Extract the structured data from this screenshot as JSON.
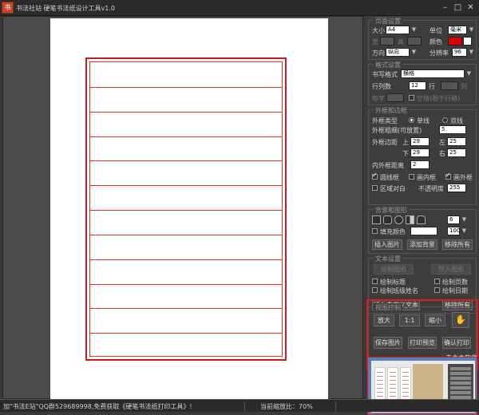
{
  "window": {
    "title": "书法社站 硬笔书法纸设计工具v1.0",
    "min": "–",
    "max": "□",
    "close": "✕"
  },
  "page_setup": {
    "title": "页面设置",
    "size_label": "大小",
    "size_value": "A4",
    "unit_label": "单位",
    "unit_value": "毫米",
    "width_label": "宽",
    "height_label": "高",
    "color_label": "颜色",
    "color_value": "#e00000",
    "orient_label": "方向",
    "orient_value": "纵向",
    "res_label": "分辨率",
    "res_value": "96"
  },
  "format": {
    "title": "格式设置",
    "style_label": "书写格式",
    "style_value": "横格",
    "rows_label": "行列数",
    "rows_value": "12",
    "rows_unit": "行",
    "cols_unit": "列",
    "word_label": "每字",
    "word_note": "空格(限于行格)"
  },
  "border": {
    "title": "外框和边框",
    "type_label": "外框类型",
    "single": "单线",
    "double": "双线",
    "width_label": "外框粗细(可放置)",
    "width_value": "5",
    "margin_label": "外框边距",
    "top": "上",
    "top_value": "29",
    "left": "左",
    "left_value": "25",
    "bottom": "下",
    "bottom_value": "29",
    "right": "右",
    "right_value": "25",
    "gap_label": "内外框距离",
    "gap_value": "2",
    "opt1": "圆线框",
    "opt2": "画内框",
    "opt3": "画外框",
    "opt4": "区域对白",
    "opacity_label": "不透明度",
    "opacity_value": "255"
  },
  "background": {
    "title": "背景和图形",
    "value": "6",
    "fill_label": "填充颜色",
    "fill_value": "100",
    "btn1": "插入图片",
    "btn2": "添加背景",
    "btn3": "移除所有"
  },
  "text": {
    "title": "文本设置",
    "btn_a": "绘制图形",
    "btn_b": "导入图形",
    "c1": "绘制标题",
    "c2": "绘制页数",
    "c3": "绘制班级姓名",
    "c4": "绘制日期",
    "btn1": "插入自定义文本",
    "btn2": "移除所有"
  },
  "view": {
    "title": "视图控制",
    "zoom_in": "放大",
    "actual": "1:1",
    "zoom_out": "缩小",
    "save": "保存图片",
    "print_settings": "打印预览",
    "print": "确认打印",
    "link": "去主本软件"
  },
  "status": {
    "left": "加\"书法E站\"QQ群529689998,免费获取《硬笔书法纸打印工具》!",
    "zoom": "当前缩放比：70%"
  },
  "paper_line_count": 11
}
